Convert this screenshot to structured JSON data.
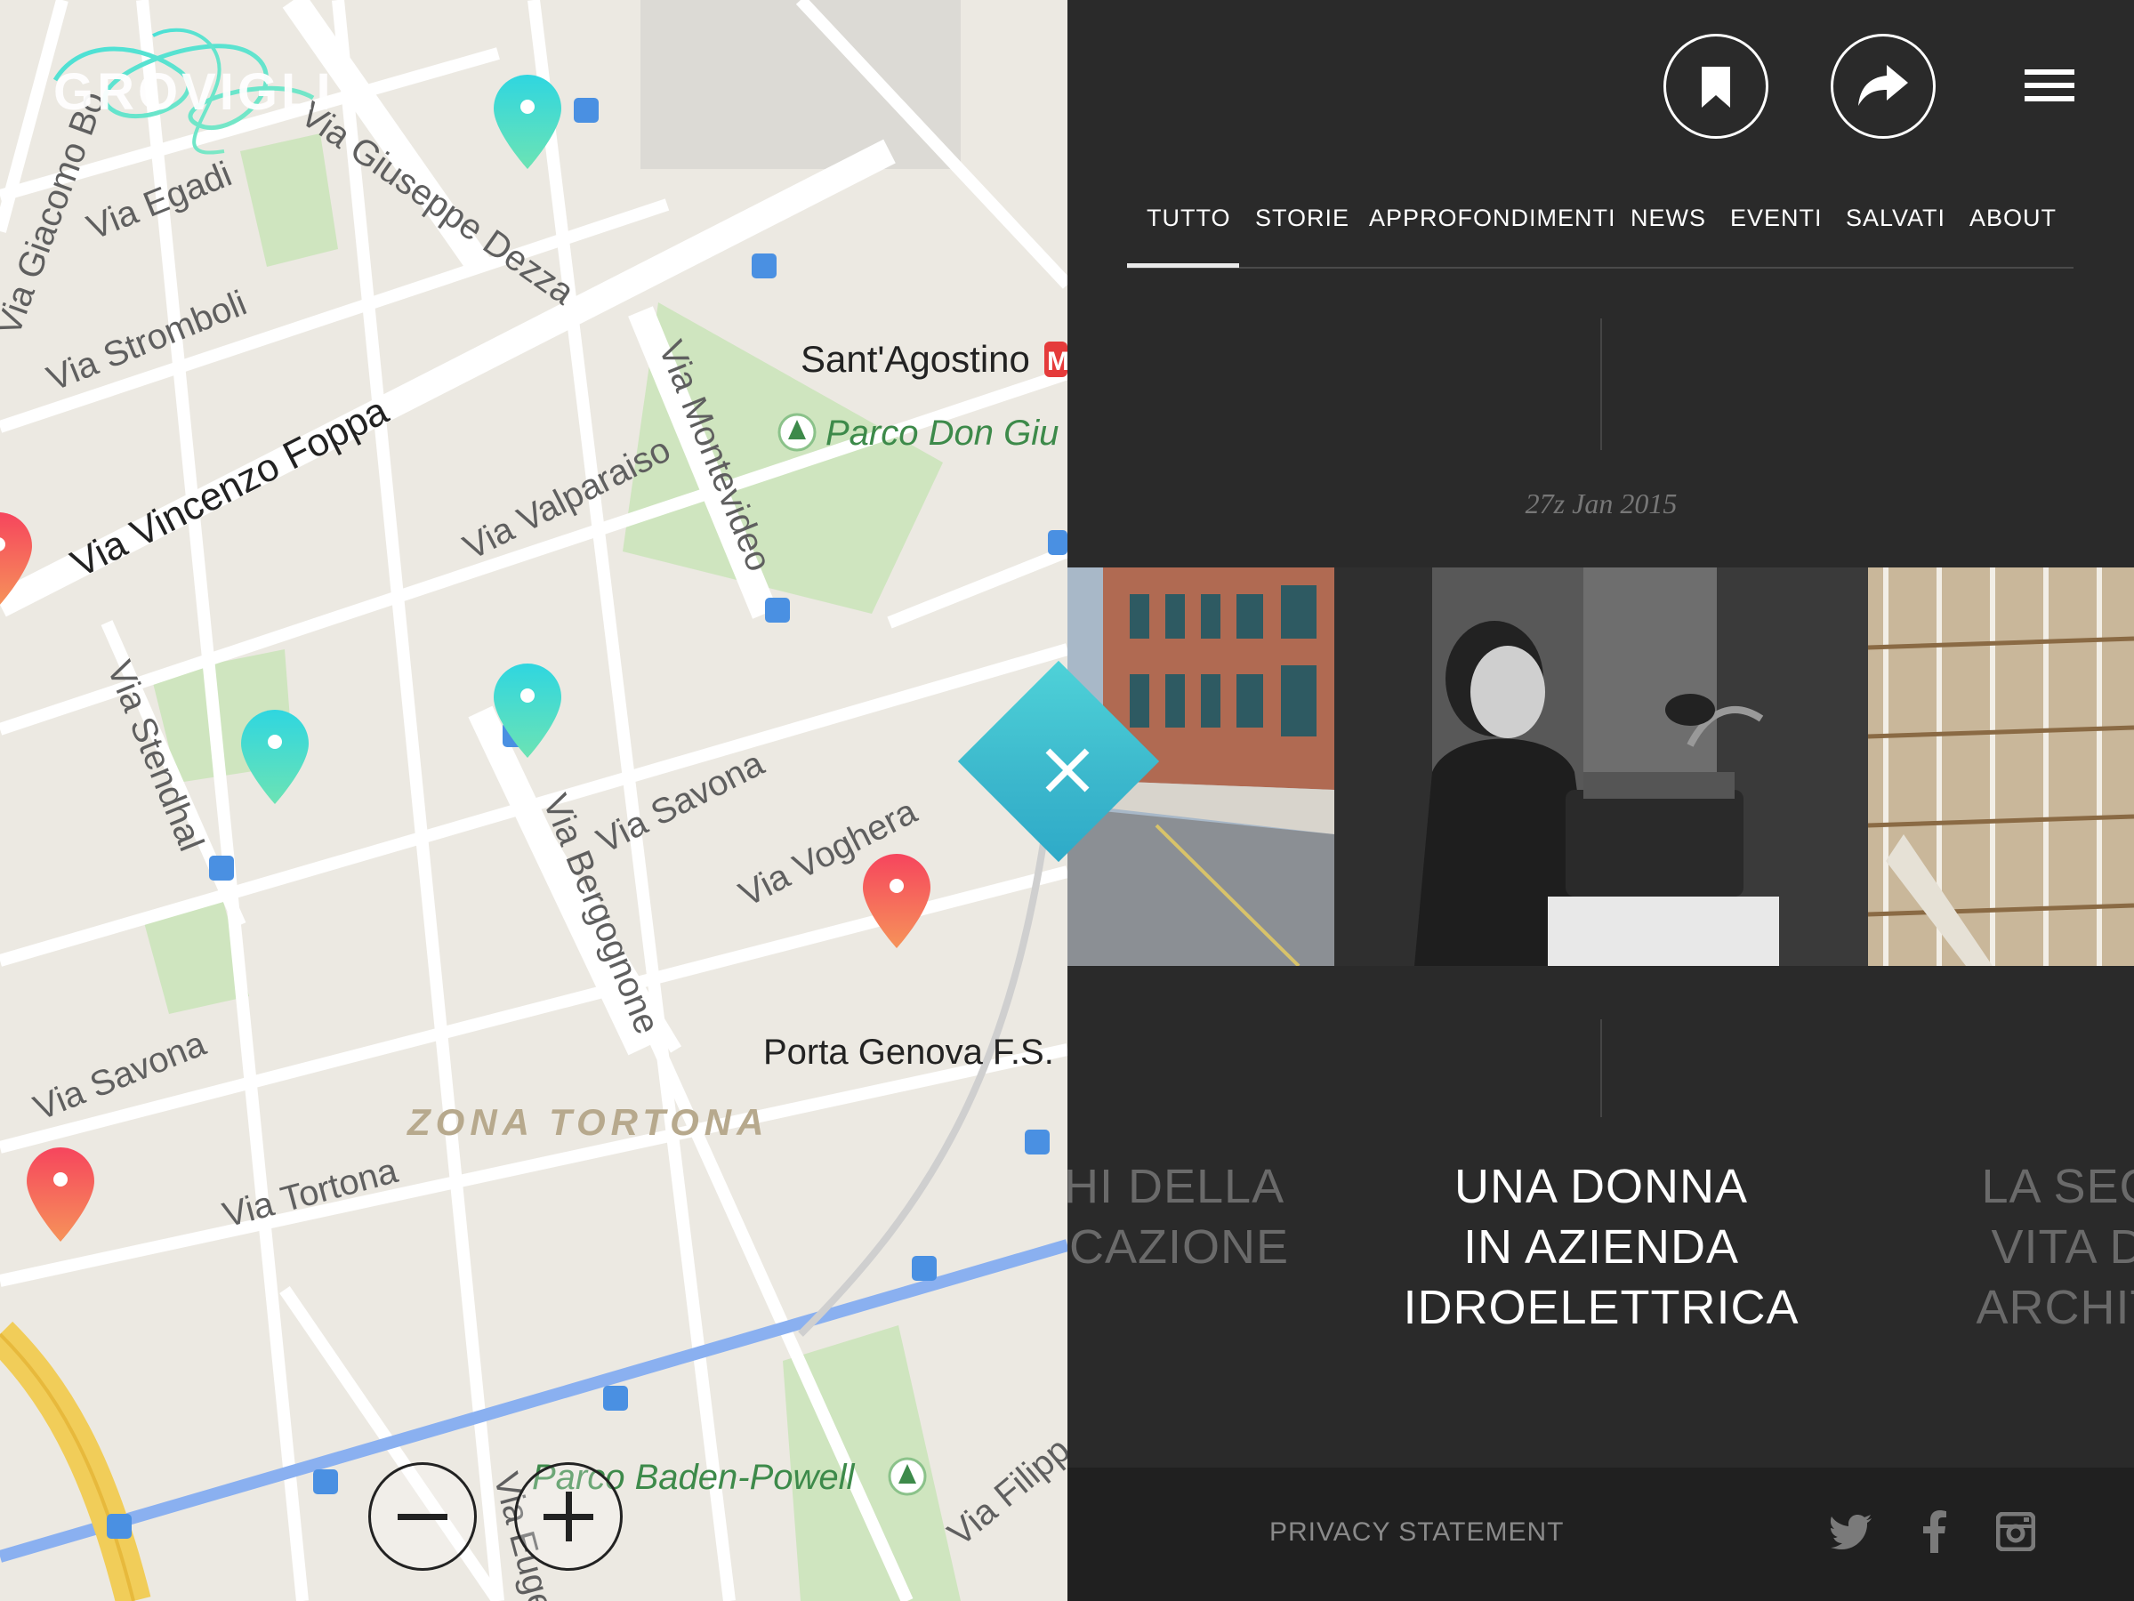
{
  "app": {
    "logo_text": "GROVIGLI"
  },
  "map": {
    "streets": {
      "via_giacomo": "Via Giacomo Bo",
      "via_egadi": "Via Egadi",
      "via_giuseppe_dezza": "Via Giuseppe Dezza",
      "via_stromboli": "Via Stromboli",
      "via_vincenzo_foppa": "Via Vincenzo Foppa",
      "via_valparaiso": "Via Valparaiso",
      "via_montevideo": "Via Montevideo",
      "via_stendhal": "Via Stendhal",
      "via_savona_1": "Via Savona",
      "via_bergognone": "Via Bergognone",
      "via_voghera": "Via Voghera",
      "via_savona_2": "Via Savona",
      "via_tortona": "Via Tortona",
      "via_euge": "Via Euge",
      "via_filipp": "Via Filipp"
    },
    "places": {
      "sant_agostino": "Sant'Agostino",
      "metro_badge": "M",
      "parco_don": "Parco Don Giu",
      "porta_genova": "Porta Genova F.S.",
      "zona_tortona": "ZONA TORTONA",
      "parco_baden": "Parco Baden-Powell"
    },
    "pin_colors": {
      "teal": "#3fd6cf",
      "red": "#f0524f"
    },
    "zoom_out_icon": "minus-icon",
    "zoom_in_icon": "plus-icon"
  },
  "header": {
    "bookmark_icon": "bookmark-icon",
    "share_icon": "share-icon",
    "menu_icon": "hamburger-menu-icon"
  },
  "nav": {
    "items": [
      {
        "label": "TUTTO",
        "active": true
      },
      {
        "label": "STORIE",
        "active": false
      },
      {
        "label": "APPROFONDIMENTI",
        "active": false
      },
      {
        "label": "NEWS",
        "active": false
      },
      {
        "label": "EVENTI",
        "active": false
      },
      {
        "label": "SALVATI",
        "active": false
      },
      {
        "label": "ABOUT",
        "active": false
      }
    ]
  },
  "feed": {
    "date": "27z Jan 2015",
    "stories": [
      {
        "lines": [
          "HI DELLA",
          "CAZIONE"
        ]
      },
      {
        "lines": [
          "UNA DONNA",
          "IN AZIENDA",
          "IDROELETTRICA"
        ]
      },
      {
        "lines": [
          "LA SEC",
          "VITA D",
          "ARCHIT"
        ]
      }
    ]
  },
  "footer": {
    "privacy": "PRIVACY STATEMENT",
    "social": [
      "twitter-icon",
      "facebook-icon",
      "instagram-icon"
    ]
  },
  "colors": {
    "panel_bg": "#2a2a2a",
    "footer_bg": "#202020",
    "accent_teal": "#3fc6d3",
    "map_bg": "#ece9e2"
  }
}
